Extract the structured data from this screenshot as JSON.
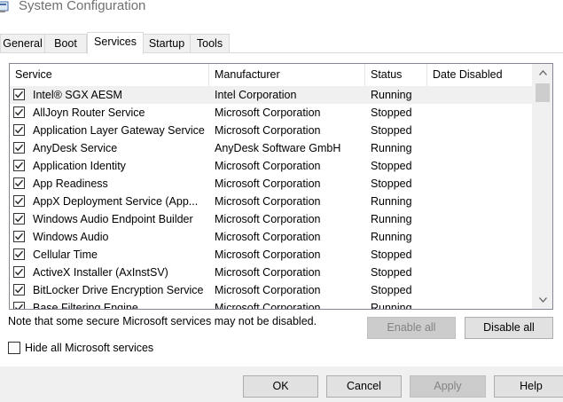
{
  "window": {
    "title": "System Configuration"
  },
  "tabs": [
    {
      "label": "General",
      "active": false
    },
    {
      "label": "Boot",
      "active": false
    },
    {
      "label": "Services",
      "active": true
    },
    {
      "label": "Startup",
      "active": false
    },
    {
      "label": "Tools",
      "active": false
    }
  ],
  "services_list": {
    "columns": [
      "Service",
      "Manufacturer",
      "Status",
      "Date Disabled"
    ],
    "rows": [
      {
        "checked": true,
        "service": "Intel® SGX AESM",
        "manufacturer": "Intel Corporation",
        "status": "Running",
        "date_disabled": ""
      },
      {
        "checked": true,
        "service": "AllJoyn Router Service",
        "manufacturer": "Microsoft Corporation",
        "status": "Stopped",
        "date_disabled": ""
      },
      {
        "checked": true,
        "service": "Application Layer Gateway Service",
        "manufacturer": "Microsoft Corporation",
        "status": "Stopped",
        "date_disabled": ""
      },
      {
        "checked": true,
        "service": "AnyDesk Service",
        "manufacturer": "AnyDesk Software GmbH",
        "status": "Running",
        "date_disabled": ""
      },
      {
        "checked": true,
        "service": "Application Identity",
        "manufacturer": "Microsoft Corporation",
        "status": "Stopped",
        "date_disabled": ""
      },
      {
        "checked": true,
        "service": "App Readiness",
        "manufacturer": "Microsoft Corporation",
        "status": "Stopped",
        "date_disabled": ""
      },
      {
        "checked": true,
        "service": "AppX Deployment Service (App...",
        "manufacturer": "Microsoft Corporation",
        "status": "Running",
        "date_disabled": ""
      },
      {
        "checked": true,
        "service": "Windows Audio Endpoint Builder",
        "manufacturer": "Microsoft Corporation",
        "status": "Running",
        "date_disabled": ""
      },
      {
        "checked": true,
        "service": "Windows Audio",
        "manufacturer": "Microsoft Corporation",
        "status": "Running",
        "date_disabled": ""
      },
      {
        "checked": true,
        "service": "Cellular Time",
        "manufacturer": "Microsoft Corporation",
        "status": "Stopped",
        "date_disabled": ""
      },
      {
        "checked": true,
        "service": "ActiveX Installer (AxInstSV)",
        "manufacturer": "Microsoft Corporation",
        "status": "Stopped",
        "date_disabled": ""
      },
      {
        "checked": true,
        "service": "BitLocker Drive Encryption Service",
        "manufacturer": "Microsoft Corporation",
        "status": "Stopped",
        "date_disabled": ""
      },
      {
        "checked": true,
        "service": "Base Filtering Engine",
        "manufacturer": "Microsoft Corporation",
        "status": "Running",
        "date_disabled": ""
      }
    ]
  },
  "note": "Note that some secure Microsoft services may not be disabled.",
  "buttons": {
    "enable_all": "Enable all",
    "disable_all": "Disable all",
    "ok": "OK",
    "cancel": "Cancel",
    "apply": "Apply",
    "help": "Help"
  },
  "hide_ms": {
    "label": "Hide all Microsoft services",
    "checked": false
  },
  "icons": {
    "app": "system-configuration-icon",
    "scroll_up": "chevron-up-icon",
    "scroll_down": "chevron-down-icon",
    "check": "checkmark-icon"
  },
  "colors": {
    "selected_row": "#f0f0f0",
    "disabled_text": "#838383",
    "button_face": "#e1e1e1"
  }
}
